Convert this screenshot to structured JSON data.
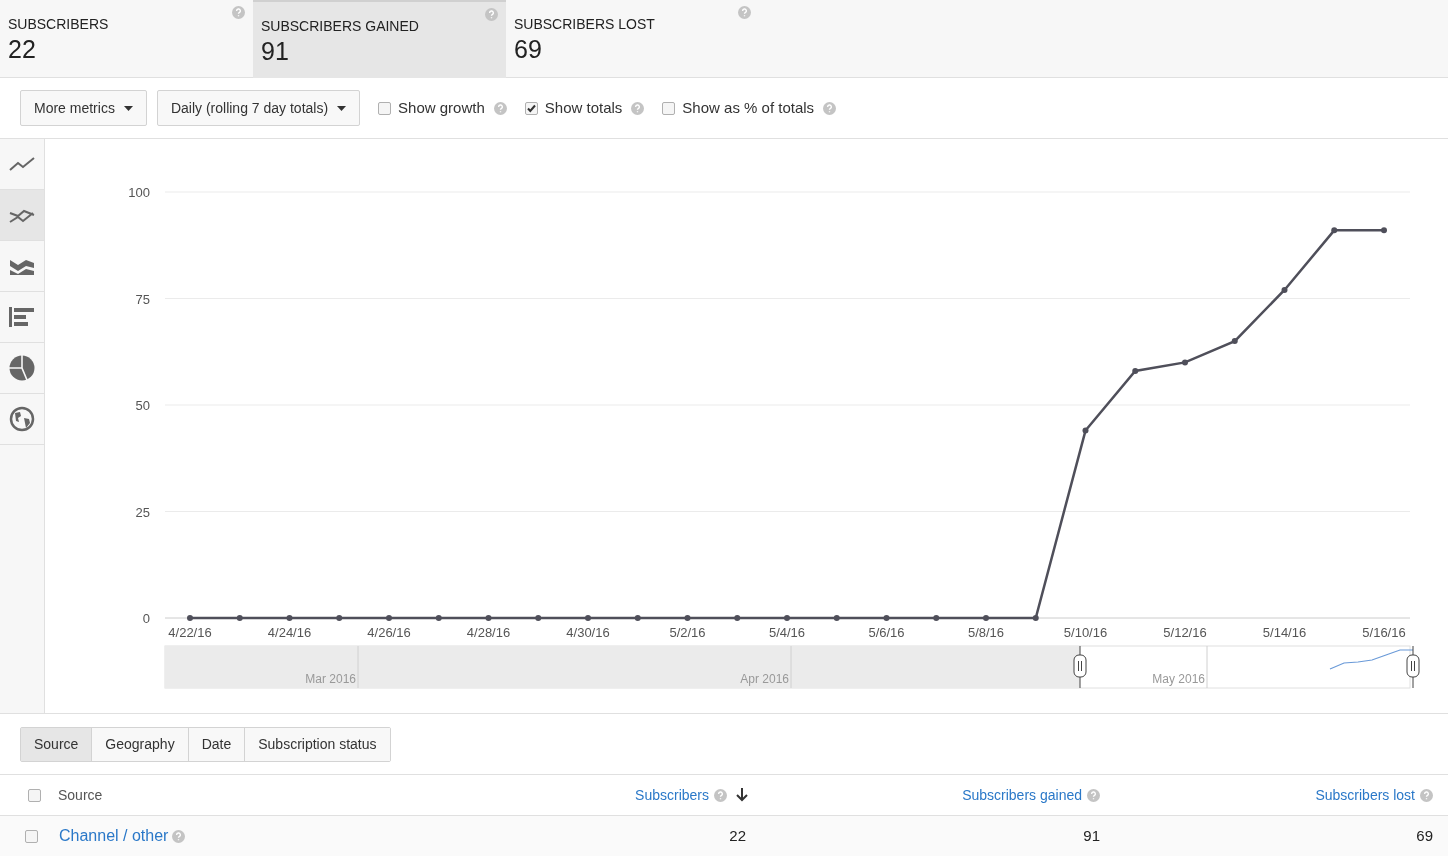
{
  "metrics": [
    {
      "label": "SUBSCRIBERS",
      "value": "22",
      "selected": false
    },
    {
      "label": "SUBSCRIBERS GAINED",
      "value": "91",
      "selected": true
    },
    {
      "label": "SUBSCRIBERS LOST",
      "value": "69",
      "selected": false
    }
  ],
  "toolbar": {
    "dropdowns": [
      "More metrics",
      "Daily (rolling 7 day totals)"
    ],
    "options": [
      {
        "label": "Show growth",
        "checked": false
      },
      {
        "label": "Show totals",
        "checked": true
      },
      {
        "label": "Show as % of totals",
        "checked": false
      }
    ]
  },
  "chart_types": [
    {
      "kind": "line",
      "selected": false
    },
    {
      "kind": "multiline",
      "selected": true
    },
    {
      "kind": "area",
      "selected": false
    },
    {
      "kind": "bar",
      "selected": false
    },
    {
      "kind": "pie",
      "selected": false
    },
    {
      "kind": "map",
      "selected": false
    }
  ],
  "chart": {
    "chart_data": {
      "type": "line",
      "categories": [
        "4/22/16",
        null,
        "4/24/16",
        null,
        "4/26/16",
        null,
        "4/28/16",
        null,
        "4/30/16",
        null,
        "5/2/16",
        null,
        "5/4/16",
        null,
        "5/6/16",
        null,
        "5/8/16",
        null,
        "5/10/16",
        null,
        "5/12/16",
        null,
        "5/14/16",
        null,
        "5/16/16"
      ],
      "series": [
        {
          "color": "#4f4f5a",
          "marker": "circle",
          "values": [
            0,
            0,
            0,
            0,
            0,
            0,
            0,
            0,
            0,
            0,
            0,
            0,
            0,
            0,
            0,
            0,
            0,
            0,
            44,
            58,
            60,
            65,
            77,
            91,
            91
          ]
        }
      ],
      "grid": true,
      "ylim": [
        0,
        100
      ],
      "yticks": [
        0,
        25,
        50,
        75,
        100
      ]
    },
    "navigator": {
      "months": [
        "Mar 2016",
        "Apr 2016",
        "May 2016"
      ]
    }
  },
  "table_tabs": [
    {
      "label": "Source",
      "selected": true
    },
    {
      "label": "Geography",
      "selected": false
    },
    {
      "label": "Date",
      "selected": false
    },
    {
      "label": "Subscription status",
      "selected": false
    }
  ],
  "table": {
    "select_all_checked": false,
    "columns": [
      "Source",
      "Subscribers",
      "Subscribers gained",
      "Subscribers lost"
    ],
    "rows": [
      {
        "source": "Channel / other",
        "checked": false,
        "cells": [
          "22",
          "91",
          "69"
        ]
      }
    ]
  }
}
